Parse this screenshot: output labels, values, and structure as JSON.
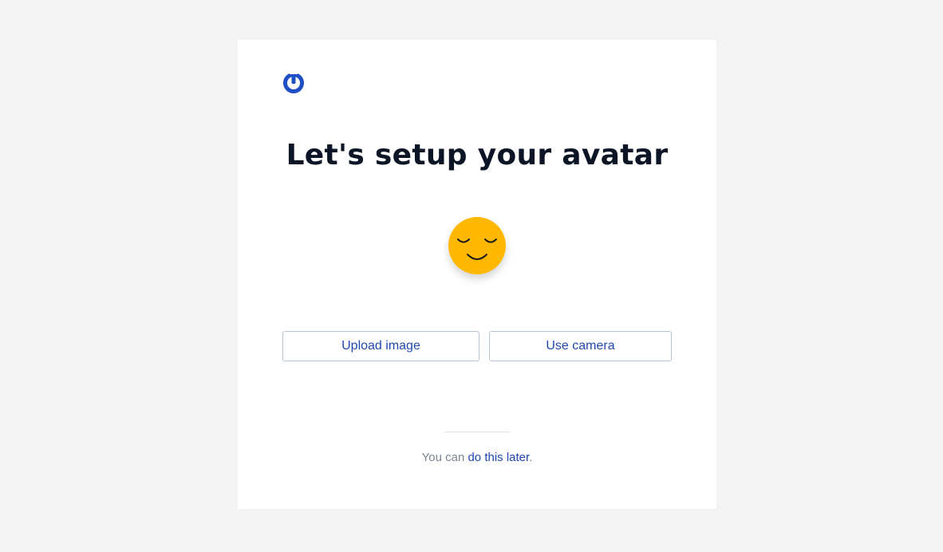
{
  "page": {
    "title": "Let's setup your avatar"
  },
  "brand": {
    "logo_icon": "power-icon",
    "accent_color": "#1f4fc4"
  },
  "avatar": {
    "icon": "smiley-face-icon",
    "color": "#ffb800"
  },
  "actions": {
    "upload_label": "Upload image",
    "camera_label": "Use camera"
  },
  "footer": {
    "prefix": "You can ",
    "link_label": "do this later",
    "suffix": "."
  }
}
